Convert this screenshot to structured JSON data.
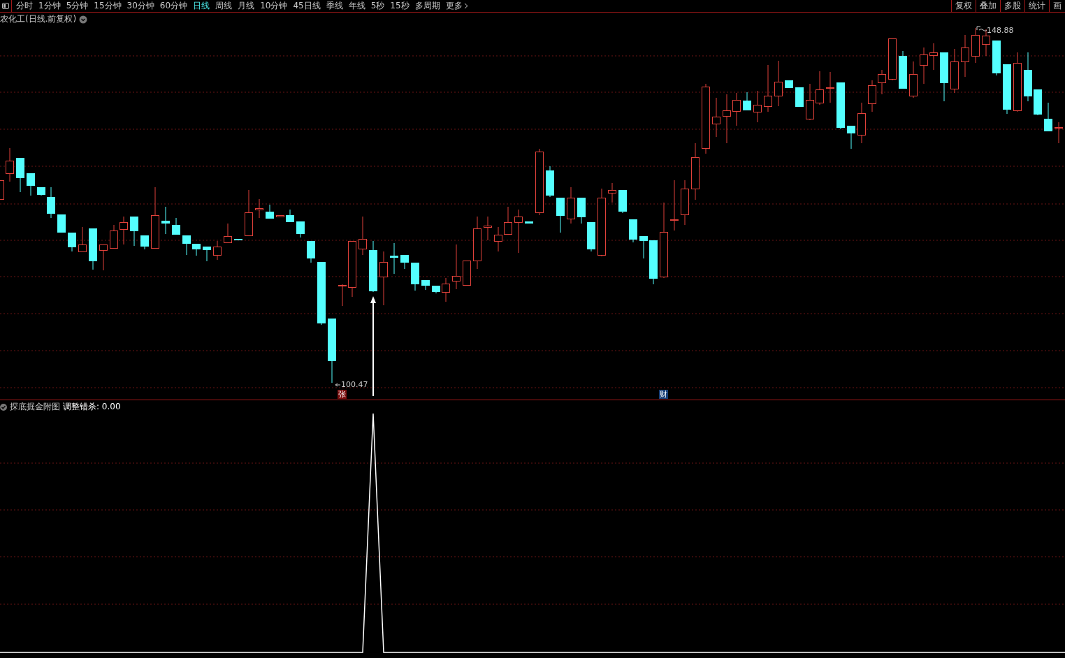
{
  "toolbar": {
    "tabs": [
      {
        "label": "分时",
        "selected": false
      },
      {
        "label": "1分钟",
        "selected": false
      },
      {
        "label": "5分钟",
        "selected": false
      },
      {
        "label": "15分钟",
        "selected": false
      },
      {
        "label": "30分钟",
        "selected": false
      },
      {
        "label": "60分钟",
        "selected": false
      },
      {
        "label": "日线",
        "selected": true
      },
      {
        "label": "周线",
        "selected": false
      },
      {
        "label": "月线",
        "selected": false
      },
      {
        "label": "10分钟",
        "selected": false
      },
      {
        "label": "45日线",
        "selected": false
      },
      {
        "label": "季线",
        "selected": false
      },
      {
        "label": "年线",
        "selected": false
      },
      {
        "label": "5秒",
        "selected": false
      },
      {
        "label": "15秒",
        "selected": false
      },
      {
        "label": "多周期",
        "selected": false
      }
    ],
    "more": {
      "label": "更多"
    },
    "right_buttons": [
      "复权",
      "叠加",
      "多股",
      "统计",
      "画"
    ]
  },
  "main_chart": {
    "title": "农化工(日线.前复权)",
    "high_label": "148.88",
    "low_label": "100.47",
    "badges": [
      {
        "label": "张",
        "kind": "rise"
      },
      {
        "label": "财",
        "kind": "finance"
      }
    ]
  },
  "sub_chart": {
    "title": "探底掘金附图",
    "indicator": "调整错杀: 0.00"
  }
}
